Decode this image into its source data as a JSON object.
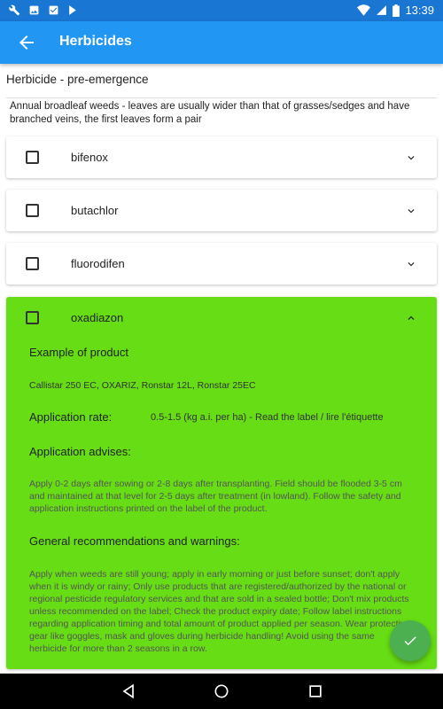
{
  "status_bar": {
    "time": "13:39"
  },
  "app_bar": {
    "title": "Herbicides"
  },
  "section": {
    "title": "Herbicide - pre-emergence",
    "description": "Annual broadleaf weeds - leaves are usually wider than that of grasses/sedges and have branched veins, the first leaves form a pair"
  },
  "items": [
    {
      "name": "bifenox"
    },
    {
      "name": "butachlor"
    },
    {
      "name": "fluorodifen"
    },
    {
      "name": "oxadiazon"
    }
  ],
  "details": {
    "example_label": "Example of product",
    "example_value": "Callistar 250 EC, OXARIZ, Ronstar 12L, Ronstar 25EC",
    "rate_label": "Application rate:",
    "rate_value": "0.5-1.5 (kg a.i. per ha) - Read the label / lire l'étiquette",
    "advises_label": "Application advises:",
    "advises_text": "Apply 0-2 days after sowing or 2-8 days after transplanting. Field should be flooded 3-5 cm and maintained at that level for 2-5 days after treatment (in lowland). Follow the safety and application instructions printed on the label of the product.",
    "recommend_label": "General recommendations and warnings:",
    "recommend_text": "Apply when weeds are still young; apply in early morning or just before sunset; don't apply when it is windy or rainy; Only use products that are registered/authorized by the national or regional pesticide regulatory services and that are sold in a sealed bottle; Don't mix products unless recommended on the label; Check the product expiry date; Follow label instructions regarding application timing and total amount of product applied per season. Wear protective gear like goggles, mask and gloves during herbicide handling! Avoid using the same herbicide for more than 2 seasons in a row."
  },
  "colors": {
    "app_bar": "#2196f3",
    "status_bar": "#1976d2",
    "expanded_card": "#66dd14",
    "fab": "#4caf50"
  }
}
